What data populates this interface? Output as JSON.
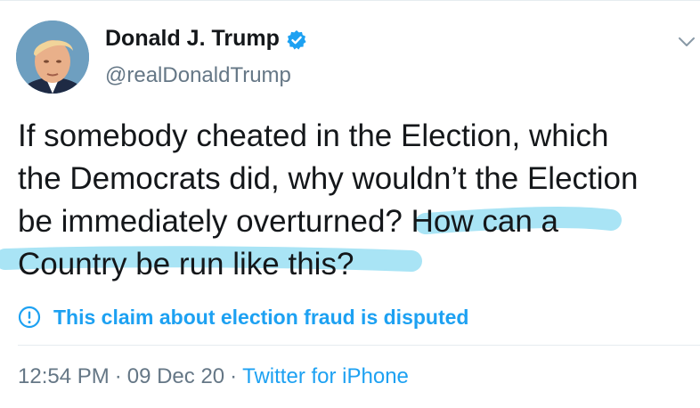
{
  "author": {
    "display_name": "Donald J. Trump",
    "handle": "@realDonaldTrump",
    "verified": true,
    "avatar_icon": "profile-photo"
  },
  "tweet": {
    "lines": [
      "If somebody cheated in the Election, which",
      "the Democrats did, why wouldn’t the Election",
      "be immediately overturned? ",
      "How can a",
      "Country be run like this?"
    ]
  },
  "notice": {
    "icon": "exclamation-circle-icon",
    "text": "This claim about election fraud is disputed"
  },
  "meta": {
    "time": "12:54 PM",
    "date": "09 Dec 20",
    "source": "Twitter for iPhone",
    "separator": "·"
  },
  "colors": {
    "link_blue": "#1da1f2",
    "secondary_gray": "#657786",
    "highlight": "#a9e4f5",
    "text": "#14171a"
  }
}
